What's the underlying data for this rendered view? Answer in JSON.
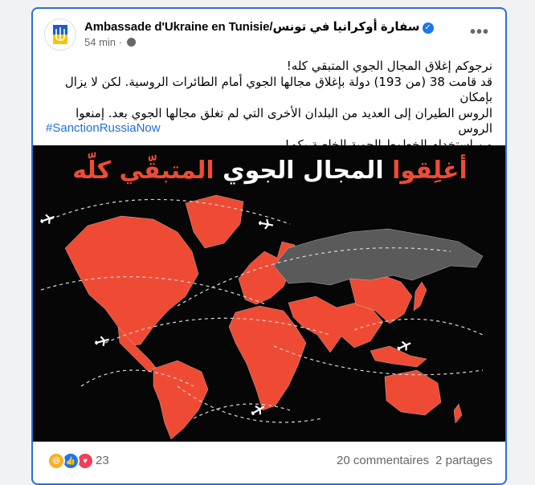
{
  "post": {
    "page_name": "Ambassade d'Ukraine en Tunisie/سفارة أوكرانيا في تونس",
    "time": "54 min",
    "time_separator": "·",
    "text_lines": [
      "نرجوكم إغلاق المجال الجوي المتبقي كله!",
      "قد قامت 38 (من 193) دولة بإغلاق مجالها الجوي أمام الطائرات الروسية. لكن لا يزال بإمكان",
      "الروس الطيران إلى العديد من البلدان الأخرى التي لم تغلق مجالها الجوي بعد. إمنعوا الروس",
      "من استخدام الخطوط الجوية الخاصة بكم!"
    ],
    "hashtag": "#SanctionRussiaNow"
  },
  "image": {
    "title_red_1": "أغلِقوا",
    "title_white": "المجال الجوي",
    "title_red_2": "المتبقّي كلّه",
    "colors": {
      "closed": "#ef4b34",
      "russia": "#5a5a5a",
      "background": "#060606"
    }
  },
  "footer": {
    "reaction_count": "23",
    "comments": "20 commentaires",
    "shares": "2 partages"
  },
  "icons": [
    "ukraine-trident-icon",
    "verified-icon",
    "globe-icon",
    "more-icon",
    "plane-icon",
    "haha-reaction-icon",
    "care-reaction-icon",
    "love-reaction-icon"
  ]
}
